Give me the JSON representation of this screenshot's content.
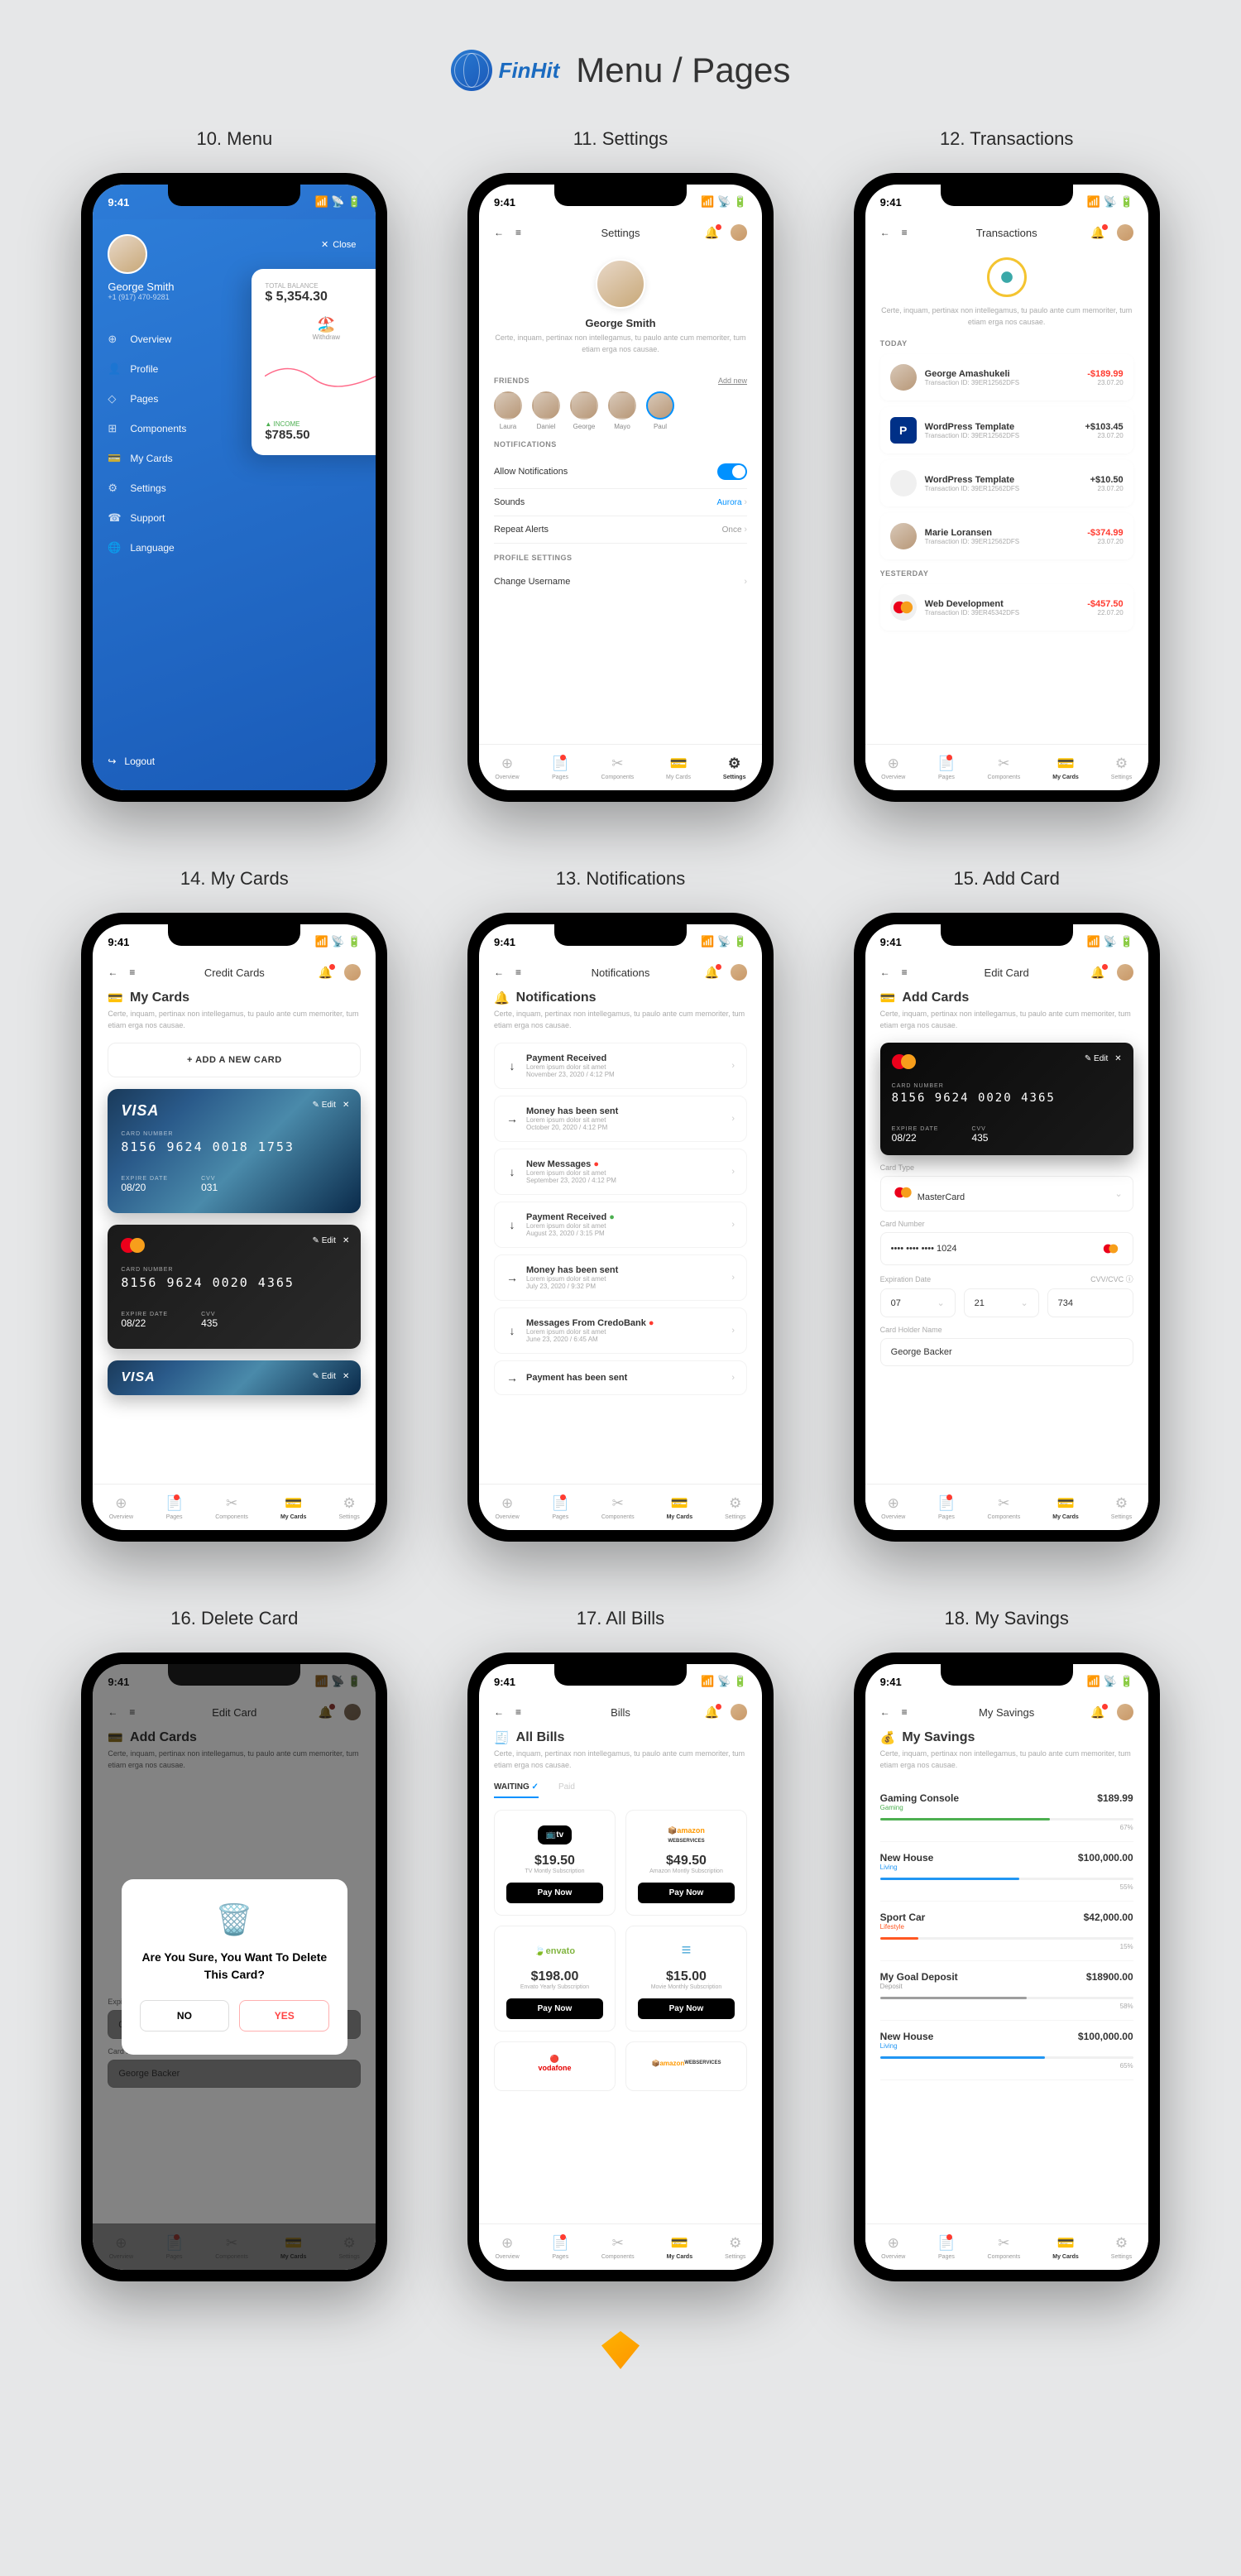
{
  "brand": {
    "name": "FinHit",
    "page_title": "Menu / Pages"
  },
  "captions": {
    "s10": "10. Menu",
    "s11": "11. Settings",
    "s12": "12. Transactions",
    "s13": "13. Notifications",
    "s14": "14. My Cards",
    "s15": "15. Add Card",
    "s16": "16. Delete Card",
    "s17": "17. All Bills",
    "s18": "18. My Savings"
  },
  "status_time": "9:41",
  "desc": "Certe, inquam, pertinax non intellegamus, tu paulo ante cum memoriter, tum etiam erga nos causae.",
  "nav": {
    "overview": "Overview",
    "pages": "Pages",
    "components": "Components",
    "mycards": "My Cards",
    "settings": "Settings"
  },
  "menu": {
    "close": "Close",
    "user": "George Smith",
    "phone": "+1 (917) 470-9281",
    "logout": "Logout",
    "items": [
      "Overview",
      "Profile",
      "Pages",
      "Components",
      "My Cards",
      "Settings",
      "Support",
      "Language"
    ],
    "peek": {
      "total_label": "TOTAL BALANCE",
      "total": "$ 5,354.30",
      "withdraw": "Withdraw",
      "income_label": "INCOME",
      "income": "$785.50"
    }
  },
  "settings": {
    "title": "Settings",
    "user": "George Smith",
    "friends_heading": "FRIENDS",
    "add_new": "Add new",
    "friends": [
      {
        "n": "Laura"
      },
      {
        "n": "Daniel"
      },
      {
        "n": "George"
      },
      {
        "n": "Mayo"
      },
      {
        "n": "Paul"
      }
    ],
    "notif_heading": "NOTIFICATIONS",
    "allow": "Allow Notifications",
    "sounds": "Sounds",
    "sounds_val": "Aurora",
    "repeat": "Repeat Alerts",
    "repeat_val": "Once",
    "profile_heading": "PROFILE SETTINGS",
    "change_user": "Change Username"
  },
  "transactions": {
    "title": "Transactions",
    "today": "TODAY",
    "yesterday": "YESTERDAY",
    "list": [
      {
        "name": "George Amashukeli",
        "id": "Transaction ID: 39ER12562DFS",
        "amt": "-$189.99",
        "date": "23.07.20",
        "neg": true,
        "av": "person"
      },
      {
        "name": "WordPress Template",
        "id": "Transaction ID: 39ER12562DFS",
        "amt": "+$103.45",
        "date": "23.07.20",
        "neg": false,
        "av": "paypal"
      },
      {
        "name": "WordPress Template",
        "id": "Transaction ID: 39ER12562DFS",
        "amt": "+$10.50",
        "date": "23.07.20",
        "neg": false,
        "av": "apple"
      },
      {
        "name": "Marie Loransen",
        "id": "Transaction ID: 39ER12562DFS",
        "amt": "-$374.99",
        "date": "23.07.20",
        "neg": true,
        "av": "person"
      }
    ],
    "yesterday_item": {
      "name": "Web Development",
      "id": "Transaction ID: 39ER45342DFS",
      "amt": "-$457.50",
      "date": "22.07.20",
      "neg": true,
      "av": "mc"
    }
  },
  "mycards": {
    "title": "Credit Cards",
    "heading": "My Cards",
    "add": "ADD A NEW CARD",
    "edit": "Edit",
    "card_label": "CARD NUMBER",
    "exp_label": "EXPIRE DATE",
    "cvv_label": "CVV",
    "c1": {
      "brand": "VISA",
      "num": "8156 9624 0018 1753",
      "exp": "08/20",
      "cvv": "031"
    },
    "c2": {
      "brand": "MasterCard",
      "num": "8156 9624 0020 4365",
      "exp": "08/22",
      "cvv": "435"
    },
    "c3": {
      "brand": "VISA"
    }
  },
  "notifications": {
    "title": "Notifications",
    "heading": "Notifications",
    "items": [
      {
        "dir": "down",
        "t": "Payment Received",
        "s": "Lorem ipsum dolor sit amet",
        "d": "November 23, 2020 / 4:12 PM"
      },
      {
        "dir": "right",
        "t": "Money has been sent",
        "s": "Lorem ipsum dolor sit amet",
        "d": "October 20, 2020 / 4:12 PM"
      },
      {
        "dir": "down",
        "t": "New Messages",
        "s": "Lorem ipsum dolor sit amet",
        "d": "September 23, 2020 / 4:12 PM",
        "badge": true
      },
      {
        "dir": "down",
        "t": "Payment Received",
        "s": "Lorem ipsum dolor sit amet",
        "d": "August 23, 2020 / 3:15 PM",
        "tick": true
      },
      {
        "dir": "right",
        "t": "Money has been sent",
        "s": "Lorem ipsum dolor sit amet",
        "d": "July 23, 2020 / 9:32 PM"
      },
      {
        "dir": "down",
        "t": "Messages From CredoBank",
        "s": "Lorem ipsum dolor sit amet",
        "d": "June 23, 2020 / 6:45 AM",
        "badge": true
      },
      {
        "dir": "right",
        "t": "Payment has been sent",
        "s": "",
        "d": ""
      }
    ]
  },
  "addcard": {
    "title": "Edit Card",
    "heading": "Add Cards",
    "edit": "Edit",
    "card": {
      "num": "8156 9624 0020 4365",
      "exp": "08/22",
      "cvv": "435"
    },
    "type_label": "Card Type",
    "type_val": "MasterCard",
    "num_label": "Card Number",
    "num_val": "•••• •••• •••• 1024",
    "exp_label": "Expiration Date",
    "exp_m": "07",
    "exp_y": "21",
    "cvv_label": "CVV/CVC",
    "cvv_val": "734",
    "holder_label": "Card Holder Name",
    "holder_val": "George Backer"
  },
  "deletecard": {
    "title": "Edit Card",
    "heading": "Add Cards",
    "modal": {
      "text": "Are You Sure, You Want To Delete This Card?",
      "no": "NO",
      "yes": "YES"
    }
  },
  "bills": {
    "title": "Bills",
    "heading": "All Bills",
    "tab_waiting": "WAITING",
    "tab_paid": "Paid",
    "pay": "Pay Now",
    "list": [
      {
        "logo": "tv",
        "name": "tv",
        "price": "$19.50",
        "sub": "TV Montly Subscription"
      },
      {
        "logo": "amazon",
        "name": "amazon webservices",
        "price": "$49.50",
        "sub": "Amazon Montly Subscription"
      },
      {
        "logo": "envato",
        "name": "envato",
        "price": "$198.00",
        "sub": "Envato Yearly Subscription"
      },
      {
        "logo": "movie",
        "name": "≡",
        "price": "$15.00",
        "sub": "Movie Monthly Subscription"
      }
    ],
    "extra": [
      {
        "name": "vodafone"
      },
      {
        "name": "amazon webservices"
      }
    ]
  },
  "savings": {
    "title": "My Savings",
    "heading": "My Savings",
    "list": [
      {
        "name": "Gaming Console",
        "cat": "Gaming",
        "amt": "$189.99",
        "pct": 67,
        "color": "#4caf50"
      },
      {
        "name": "New House",
        "cat": "Living",
        "amt": "$100,000.00",
        "pct": 55,
        "color": "#2196f3"
      },
      {
        "name": "Sport Car",
        "cat": "Lifestyle",
        "amt": "$42,000.00",
        "pct": 15,
        "color": "#ff5722"
      },
      {
        "name": "My Goal Deposit",
        "cat": "Deposit",
        "amt": "$18900.00",
        "pct": 58,
        "color": "#9e9e9e"
      },
      {
        "name": "New House",
        "cat": "Living",
        "amt": "$100,000.00",
        "pct": 65,
        "color": "#2196f3"
      }
    ]
  }
}
